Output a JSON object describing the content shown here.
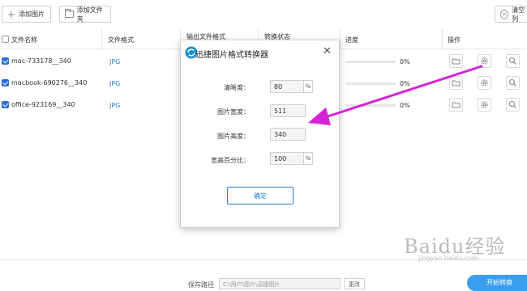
{
  "toolbar": {
    "add_image": "添加图片",
    "add_folder": "添加文件夹",
    "clear": "清空列"
  },
  "table": {
    "headers": {
      "name": "文件名称",
      "format": "文件格式",
      "output_format": "输出文件格式",
      "status": "转换状态",
      "progress": "进度",
      "actions": "操作"
    },
    "rows": [
      {
        "name": "mac-733178__340",
        "format": "JPG",
        "progress": "0%",
        "progress_fraction": 0
      },
      {
        "name": "macbook-690276__340",
        "format": "JPG",
        "progress": "0%",
        "progress_fraction": 0
      },
      {
        "name": "office-923169__340",
        "format": "JPG",
        "progress": "0%",
        "progress_fraction": 0
      }
    ]
  },
  "dialog": {
    "title": "迅捷图片格式转换器",
    "fields": {
      "clarity": {
        "label": "清晰度：",
        "value": "80",
        "unit": "%"
      },
      "width": {
        "label": "图片宽度：",
        "value": "511"
      },
      "height": {
        "label": "图片高度：",
        "value": "340"
      },
      "ratio": {
        "label": "宽高百分比：",
        "value": "100",
        "unit": "%"
      }
    },
    "ok": "确定"
  },
  "bottom": {
    "path_label": "保存路径",
    "path_value": "C:\\用户\\图片\\迅捷图片",
    "change": "更改",
    "start": "开始转换"
  },
  "watermark": {
    "brand": "Baidu经验",
    "url": "jingyan.baidu.com"
  },
  "colors": {
    "accent_blue": "#2a7fd4",
    "checkbox_blue": "#2a6fdb",
    "arrow_magenta": "#d623d6",
    "logo_blue": "#1c8fd6"
  }
}
